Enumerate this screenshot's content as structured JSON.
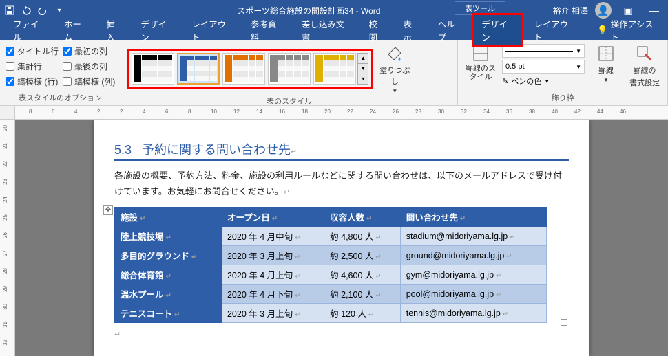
{
  "title": "スポーツ総合施設の開設計画34 - Word",
  "contextual_label": "表ツール",
  "user_name": "裕介 相澤",
  "ribbon_tabs": [
    "ファイル",
    "ホーム",
    "挿入",
    "デザイン",
    "レイアウト",
    "参考資料",
    "差し込み文書",
    "校閲",
    "表示",
    "ヘルプ"
  ],
  "contextual_tabs": [
    "デザイン",
    "レイアウト"
  ],
  "tell_me": "操作アシスト",
  "style_options": {
    "header_row": {
      "label": "タイトル行",
      "checked": true
    },
    "total_row": {
      "label": "集計行",
      "checked": false
    },
    "banded_rows": {
      "label": "縞模様 (行)",
      "checked": true
    },
    "first_col": {
      "label": "最初の列",
      "checked": true
    },
    "last_col": {
      "label": "最後の列",
      "checked": false
    },
    "banded_cols": {
      "label": "縞模様 (列)",
      "checked": false
    }
  },
  "group_labels": {
    "options": "表スタイルのオプション",
    "styles": "表のスタイル",
    "borders": "飾り枠"
  },
  "shading": "塗りつぶし",
  "border_styles": "罫線のスタイル",
  "pen_weight": "0.5 pt",
  "pen_color": "ペンの色",
  "borders_btn": "罫線",
  "border_painter_l1": "罫線の",
  "border_painter_l2": "書式設定",
  "ruler_h": [
    8,
    6,
    4,
    2,
    2,
    4,
    6,
    8,
    10,
    12,
    14,
    16,
    18,
    20,
    22,
    24,
    26,
    28,
    30,
    32,
    34,
    36,
    38,
    40,
    42,
    44,
    46
  ],
  "ruler_v": [
    20,
    21,
    22,
    23,
    24,
    25,
    26,
    27,
    28,
    29,
    30,
    31,
    32
  ],
  "heading_num": "5.3",
  "heading_text": "予約に関する問い合わせ先",
  "para_text": "各施設の概要、予約方法、料金、施設の利用ルールなどに関する問い合わせは、以下のメールアドレスで受け付けています。お気軽にお問合せください。",
  "table": {
    "headers": [
      "施設",
      "オープン日",
      "収容人数",
      "問い合わせ先"
    ],
    "rows": [
      {
        "name": "陸上競技場",
        "open": "2020 年 4 月中旬",
        "cap": "約 4,800 人",
        "mail": "stadium@midoriyama.lg.jp"
      },
      {
        "name": "多目的グラウンド",
        "open": "2020 年 3 月上旬",
        "cap": "約 2,500 人",
        "mail": "ground@midoriyama.lg.jp"
      },
      {
        "name": "総合体育館",
        "open": "2020 年 4 月上旬",
        "cap": "約 4,600 人",
        "mail": "gym@midoriyama.lg.jp"
      },
      {
        "name": "温水プール",
        "open": "2020 年 4 月下旬",
        "cap": "約 2,100 人",
        "mail": "pool@midoriyama.lg.jp"
      },
      {
        "name": "テニスコート",
        "open": "2020 年 3 月上旬",
        "cap": "約 120 人",
        "mail": "tennis@midoriyama.lg.jp"
      }
    ]
  },
  "thumb_colors": [
    "#000",
    "#2e5ea8",
    "#e07000",
    "#888",
    "#e0b000"
  ]
}
